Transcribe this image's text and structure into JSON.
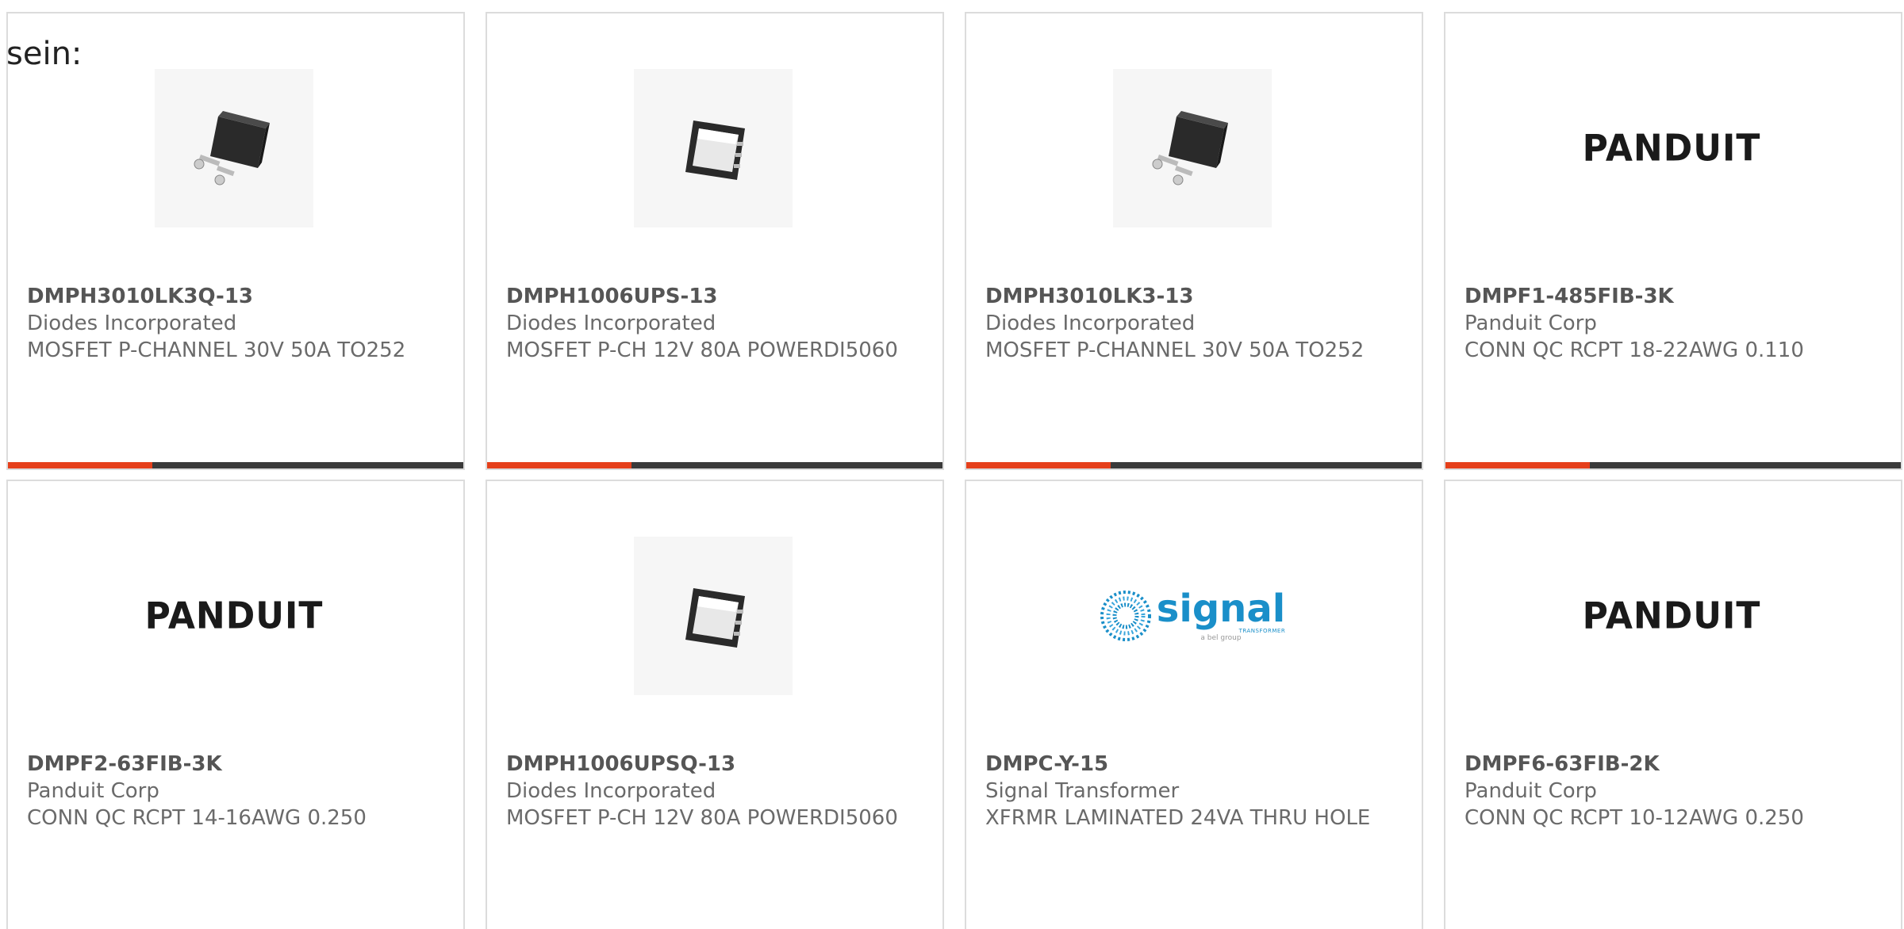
{
  "intro": {
    "text": "sein:"
  },
  "colors": {
    "accent": "#e5401b",
    "bar": "#3a3a3a",
    "border": "#dcdcdc",
    "signal_blue": "#1a8fc9"
  },
  "products": [
    {
      "part_number": "DMPH3010LK3Q-13",
      "manufacturer": "Diodes Incorporated",
      "description": "MOSFET P-CHANNEL 30V 50A TO252",
      "image": "to252-package-image"
    },
    {
      "part_number": "DMPH1006UPS-13",
      "manufacturer": "Diodes Incorporated",
      "description": "MOSFET P-CH 12V 80A POWERDI5060",
      "image": "powerdi5060-package-image"
    },
    {
      "part_number": "DMPH3010LK3-13",
      "manufacturer": "Diodes Incorporated",
      "description": "MOSFET P-CHANNEL 30V 50A TO252",
      "image": "to252-package-image"
    },
    {
      "part_number": "DMPF1-485FIB-3K",
      "manufacturer": "Panduit Corp",
      "description": "CONN QC RCPT 18-22AWG 0.110",
      "image": "panduit-logo",
      "logo_text": "PANDUIT"
    },
    {
      "part_number": "DMPF2-63FIB-3K",
      "manufacturer": "Panduit Corp",
      "description": "CONN QC RCPT 14-16AWG 0.250",
      "image": "panduit-logo",
      "logo_text": "PANDUIT"
    },
    {
      "part_number": "DMPH1006UPSQ-13",
      "manufacturer": "Diodes Incorporated",
      "description": "MOSFET P-CH 12V 80A POWERDI5060",
      "image": "powerdi5060-package-image"
    },
    {
      "part_number": "DMPC-Y-15",
      "manufacturer": "Signal Transformer",
      "description": "XFRMR LAMINATED 24VA THRU HOLE",
      "image": "signal-transformer-logo",
      "logo_text": "signal",
      "logo_sub": "TRANSFORMER",
      "logo_tag": "a bel group"
    },
    {
      "part_number": "DMPF6-63FIB-2K",
      "manufacturer": "Panduit Corp",
      "description": "CONN QC RCPT 10-12AWG 0.250",
      "image": "panduit-logo",
      "logo_text": "PANDUIT"
    }
  ]
}
